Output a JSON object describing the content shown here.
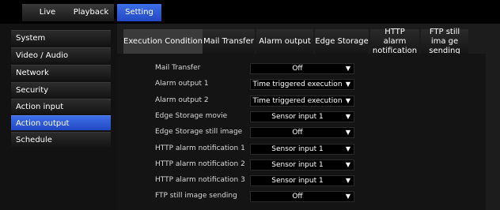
{
  "top_nav": {
    "tabs": [
      {
        "label": "Live",
        "active": false
      },
      {
        "label": "Playback",
        "active": false
      },
      {
        "label": "Setting",
        "active": true
      }
    ]
  },
  "sidebar": {
    "items": [
      {
        "label": "System",
        "active": false
      },
      {
        "label": "Video / Audio",
        "active": false
      },
      {
        "label": "Network",
        "active": false
      },
      {
        "label": "Security",
        "active": false
      },
      {
        "label": "Action input",
        "active": false
      },
      {
        "label": "Action output",
        "active": true
      },
      {
        "label": "Schedule",
        "active": false
      }
    ]
  },
  "content_tabs": [
    {
      "label": "Execution Condition",
      "active": true
    },
    {
      "label": "Mail Transfer",
      "active": false
    },
    {
      "label": "Alarm output",
      "active": false
    },
    {
      "label": "Edge Storage",
      "active": false
    },
    {
      "label": "HTTP alarm notification",
      "active": false
    },
    {
      "label": "FTP still ima ge sending",
      "active": false
    }
  ],
  "settings": [
    {
      "label": "Mail Transfer",
      "value": "Off"
    },
    {
      "label": "Alarm output 1",
      "value": "Time triggered execution"
    },
    {
      "label": "Alarm output 2",
      "value": "Time triggered execution"
    },
    {
      "label": "Edge Storage movie",
      "value": "Sensor input 1"
    },
    {
      "label": "Edge Storage still image",
      "value": "Off"
    },
    {
      "label": "HTTP alarm notification 1",
      "value": "Sensor input 1"
    },
    {
      "label": "HTTP alarm notification 2",
      "value": "Sensor input 1"
    },
    {
      "label": "HTTP alarm notification 3",
      "value": "Sensor input 1"
    },
    {
      "label": "FTP still image sending",
      "value": "Off"
    }
  ],
  "icons": {
    "dropdown_arrow": "dropdown-arrow-icon"
  },
  "colors": {
    "accent": "#2f5bd8",
    "background": "#1c1c1c"
  }
}
